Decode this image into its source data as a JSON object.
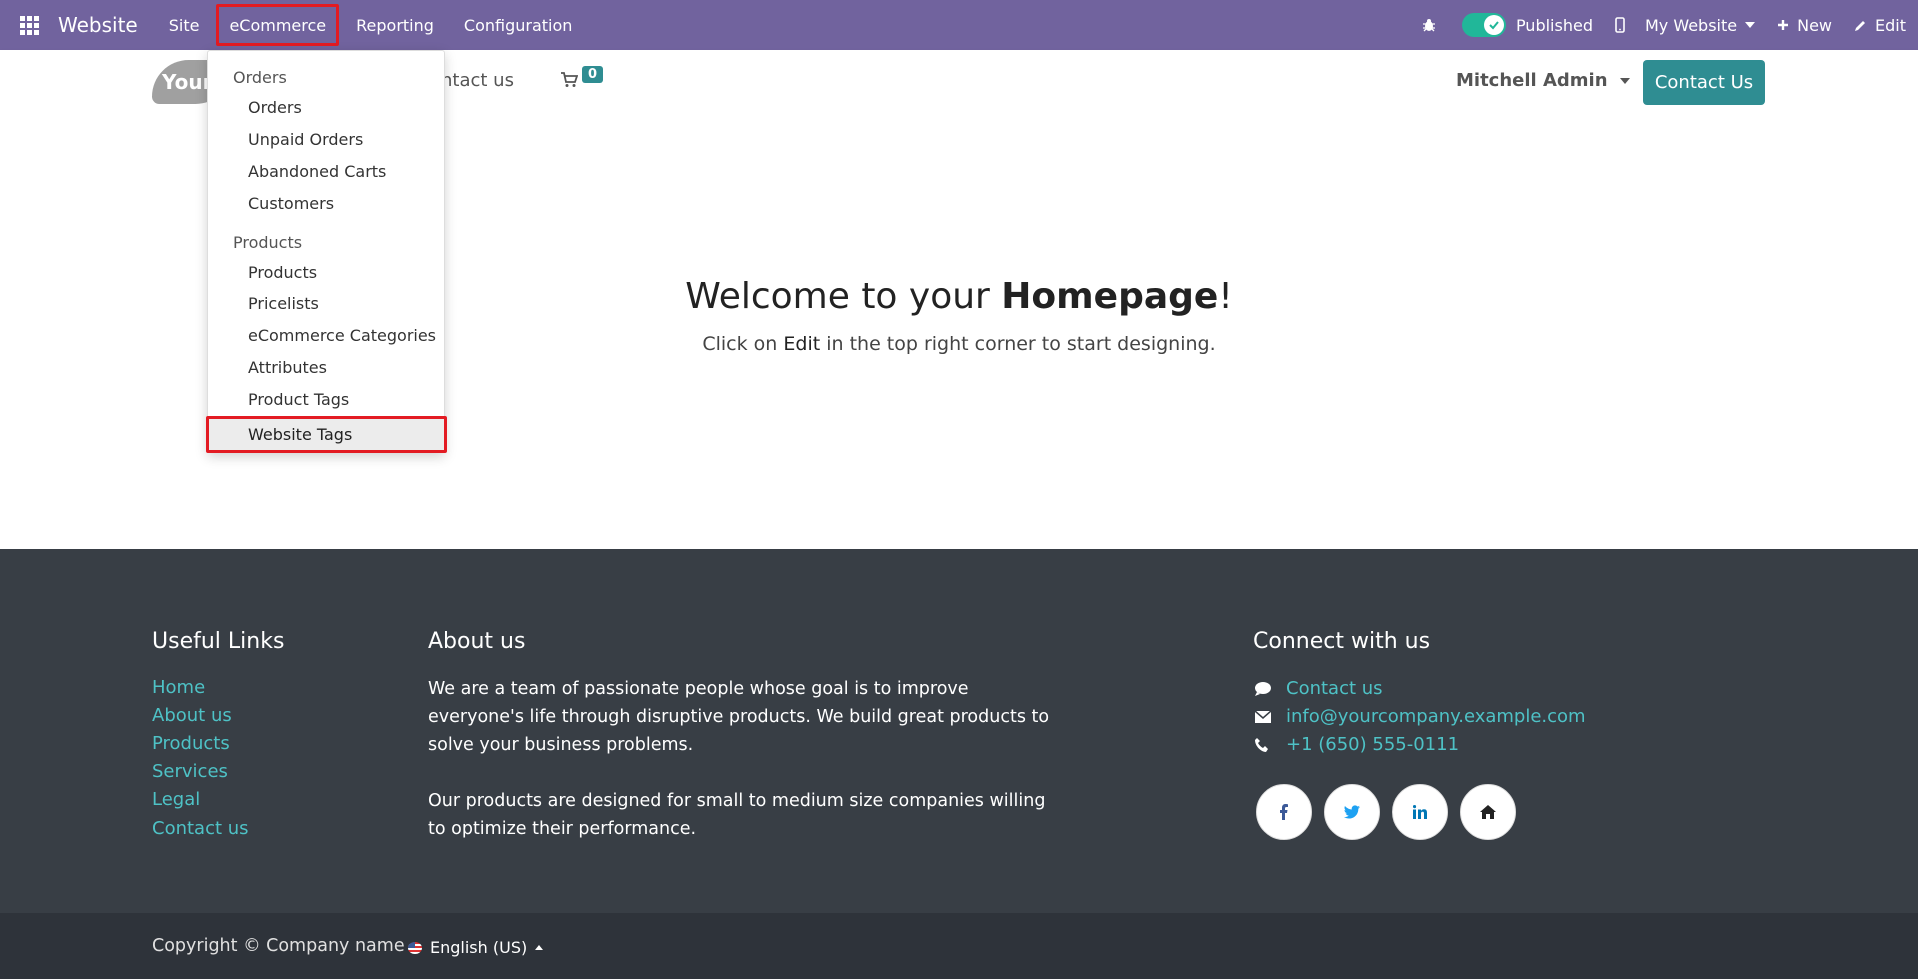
{
  "topbar": {
    "app_name": "Website",
    "menu": [
      "Site",
      "eCommerce",
      "Reporting",
      "Configuration"
    ],
    "published_label": "Published",
    "website_selector": "My Website",
    "new_label": "New",
    "edit_label": "Edit"
  },
  "header": {
    "logo_text": "Your",
    "nav_contact": "ontact us",
    "cart_count": "0",
    "user": "Mitchell Admin",
    "contact_button": "Contact Us"
  },
  "dropdown": {
    "orders_header": "Orders",
    "orders_items": [
      "Orders",
      "Unpaid Orders",
      "Abandoned Carts",
      "Customers"
    ],
    "products_header": "Products",
    "products_items": [
      "Products",
      "Pricelists",
      "eCommerce Categories",
      "Attributes",
      "Product Tags"
    ],
    "selected_item": "Website Tags"
  },
  "hero": {
    "title_prefix": "Welcome to your ",
    "title_bold": "Homepage",
    "title_suffix": "!",
    "subtitle_prefix": "Click on ",
    "subtitle_bold": "Edit",
    "subtitle_suffix": " in the top right corner to start designing."
  },
  "footer": {
    "useful_links_title": "Useful Links",
    "useful_links": [
      "Home",
      "About us",
      "Products",
      "Services",
      "Legal",
      "Contact us"
    ],
    "about_title": "About us",
    "about_p1": "We are a team of passionate people whose goal is to improve everyone's life through disruptive products. We build great products to solve your business problems.",
    "about_p2": "Our products are designed for small to medium size companies willing to optimize their performance.",
    "connect_title": "Connect with us",
    "connect_contact": "Contact us",
    "connect_email": "info@yourcompany.example.com",
    "connect_phone": "+1 (650) 555-0111",
    "social_icons": [
      "facebook-icon",
      "twitter-icon",
      "linkedin-icon",
      "home-icon"
    ]
  },
  "copyright": {
    "text": "Copyright © Company name",
    "language": "English (US)"
  },
  "colors": {
    "topbar": "#71639e",
    "accent": "#2f8d92",
    "footer": "#383e45",
    "link": "#4ec2c6",
    "highlight": "#e31b23"
  }
}
